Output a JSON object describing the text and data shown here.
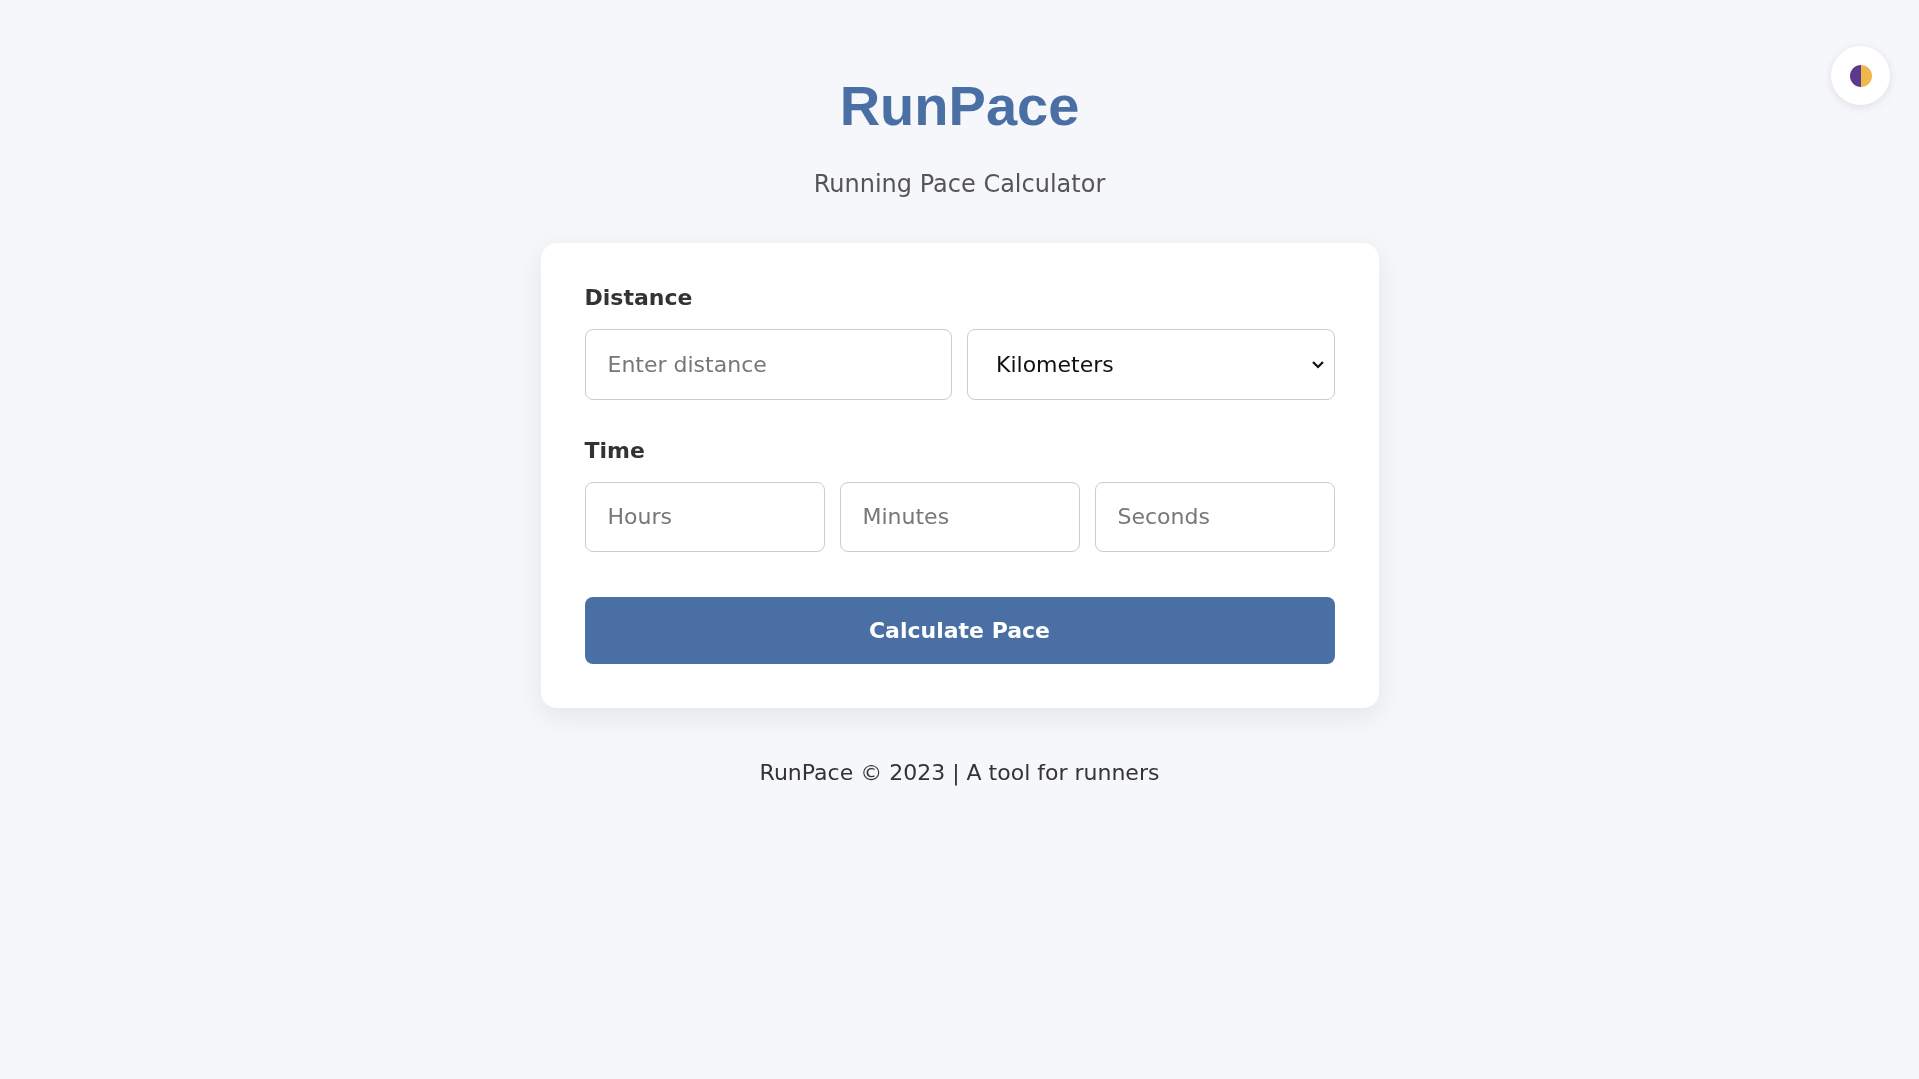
{
  "header": {
    "title": "RunPace",
    "subtitle": "Running Pace Calculator"
  },
  "form": {
    "distance": {
      "label": "Distance",
      "placeholder": "Enter distance",
      "unit": "Kilometers"
    },
    "time": {
      "label": "Time",
      "fields": [
        {
          "placeholder": "Hours"
        },
        {
          "placeholder": "Minutes"
        },
        {
          "placeholder": "Seconds"
        }
      ]
    },
    "button": "Calculate Pace"
  },
  "footer": "RunPace © 2023 | A tool for runners"
}
